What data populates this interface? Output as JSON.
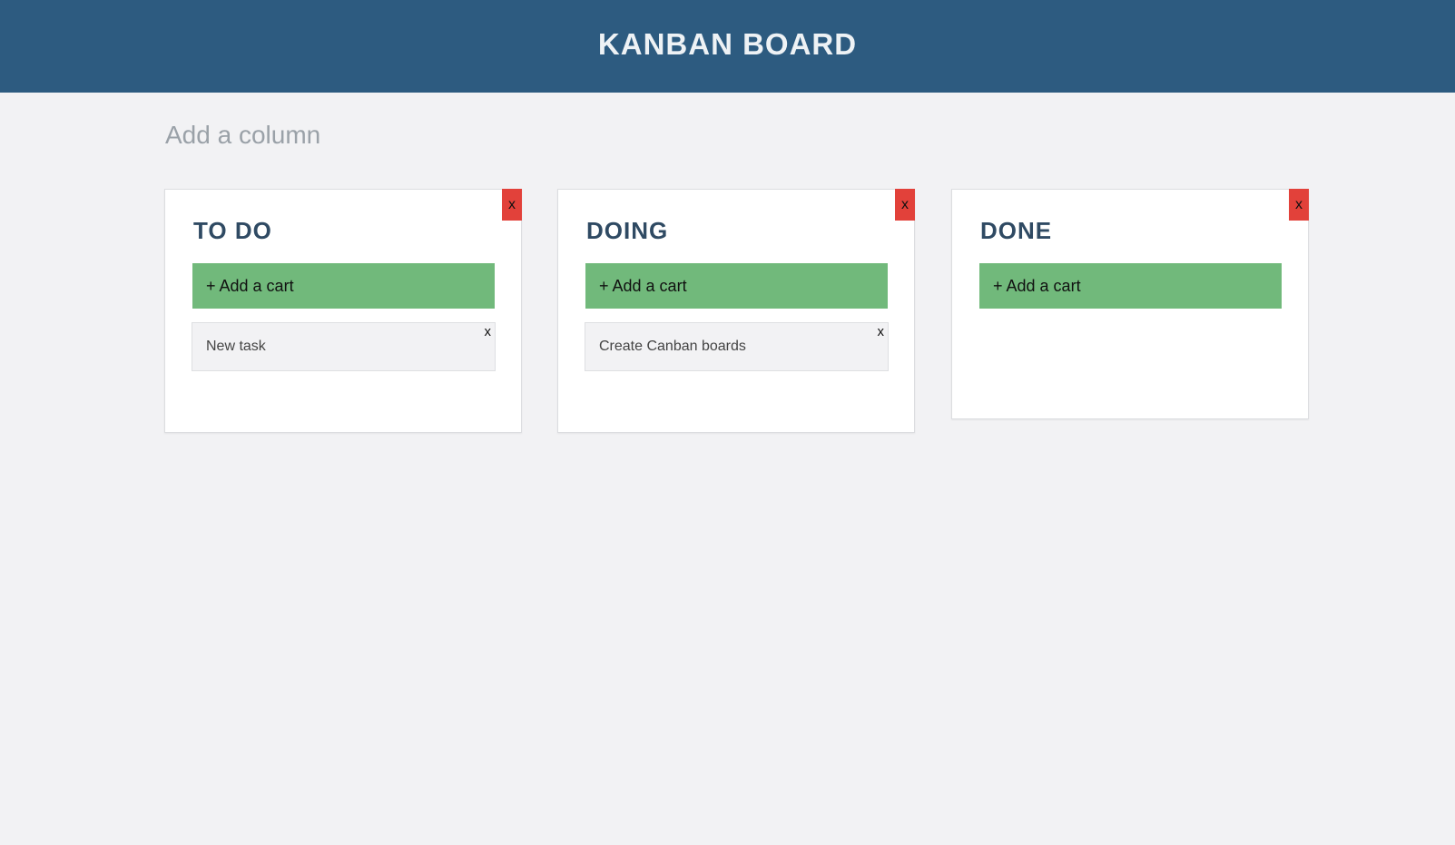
{
  "header": {
    "title": "KANBAN BOARD"
  },
  "add_column": {
    "placeholder": "Add a column"
  },
  "columns": [
    {
      "title": "TO DO",
      "delete_label": "x",
      "add_card_label": "+ Add a cart",
      "cards": [
        {
          "text": "New task",
          "delete_label": "x"
        }
      ]
    },
    {
      "title": "DOING",
      "delete_label": "x",
      "add_card_label": "+ Add a cart",
      "cards": [
        {
          "text": "Create Canban boards",
          "delete_label": "x"
        }
      ]
    },
    {
      "title": "DONE",
      "delete_label": "x",
      "add_card_label": "+ Add a cart",
      "cards": []
    }
  ],
  "colors": {
    "header_bg": "#2d5b80",
    "page_bg": "#f2f2f4",
    "delete_red": "#e2413a",
    "add_card_green": "#71b97b",
    "column_title": "#2f4a63"
  }
}
